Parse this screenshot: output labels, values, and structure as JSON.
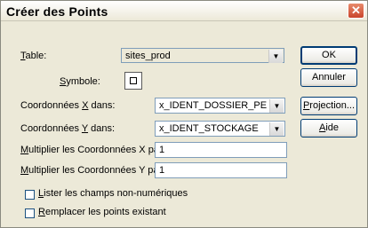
{
  "window": {
    "title": "Créer des Points",
    "close_glyph": "✕"
  },
  "form": {
    "table": {
      "label_key": "T",
      "label_rest": "able:",
      "value": "sites_prod"
    },
    "symbole": {
      "label_key": "S",
      "label_rest": "ymbole:"
    },
    "coord_x": {
      "label_pre": "Coordonnées ",
      "label_key": "X",
      "label_post": " dans:",
      "value": "x_IDENT_DOSSIER_PE"
    },
    "coord_y": {
      "label_pre": "Coordonnées ",
      "label_key": "Y",
      "label_post": " dans:",
      "value": "x_IDENT_STOCKAGE"
    },
    "mult_x": {
      "label_key": "M",
      "label_rest": "ultiplier les Coordonnées X par:",
      "value": "1"
    },
    "mult_y": {
      "label_key": "M",
      "label_rest": "ultiplier les Coordonnées Y par:",
      "value": "1"
    },
    "checkbox_lister": {
      "label_key": "L",
      "label_rest": "ister les champs non-numériques",
      "checked": false
    },
    "checkbox_remplacer": {
      "label_key": "R",
      "label_rest": "emplacer les points existant",
      "checked": false
    }
  },
  "buttons": {
    "ok": "OK",
    "annuler": "Annuler",
    "projection_key": "P",
    "projection_rest": "rojection...",
    "aide_key": "A",
    "aide_rest": "ide"
  },
  "icons": {
    "dropdown": "chevron-down-icon",
    "symbol": "square-symbol-icon",
    "close": "close-icon"
  }
}
